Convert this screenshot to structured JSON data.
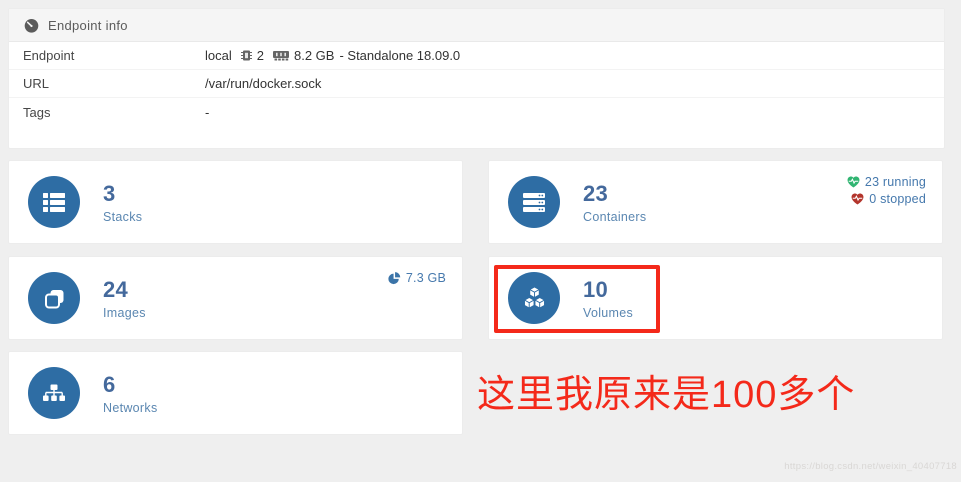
{
  "colors": {
    "accent_blue": "#2e6da4",
    "count_blue": "#44699c",
    "label_blue": "#5b87b1",
    "running_green": "#31b572",
    "stopped_red": "#b3352c",
    "annotation_red": "#f4291a",
    "page_bg": "#efefef"
  },
  "endpoint_info": {
    "title": "Endpoint info",
    "icon": "tachometer-icon",
    "rows": {
      "endpoint": {
        "label": "Endpoint",
        "name": "local",
        "cpu_icon": "microchip-icon",
        "cpu": "2",
        "memory_icon": "memory-icon",
        "memory": "8.2 GB",
        "engine": "- Standalone 18.09.0"
      },
      "url": {
        "label": "URL",
        "value": "/var/run/docker.sock"
      },
      "tags": {
        "label": "Tags",
        "value": "-"
      }
    }
  },
  "cards": {
    "stacks": {
      "count": "3",
      "label": "Stacks",
      "icon": "stacks-icon"
    },
    "containers": {
      "count": "23",
      "label": "Containers",
      "icon": "containers-icon",
      "running": "23 running",
      "running_icon": "heartbeat-green-icon",
      "stopped": "0 stopped",
      "stopped_icon": "heartbeat-red-icon"
    },
    "images": {
      "count": "24",
      "label": "Images",
      "icon": "images-icon",
      "size": "7.3 GB",
      "size_icon": "pie-chart-icon"
    },
    "volumes": {
      "count": "10",
      "label": "Volumes",
      "icon": "volumes-icon"
    },
    "networks": {
      "count": "6",
      "label": "Networks",
      "icon": "networks-icon"
    }
  },
  "annotations": {
    "highlight_box_target": "volumes-card",
    "note_text": "这里我原来是100多个"
  },
  "watermark": "https://blog.csdn.net/weixin_40407718"
}
